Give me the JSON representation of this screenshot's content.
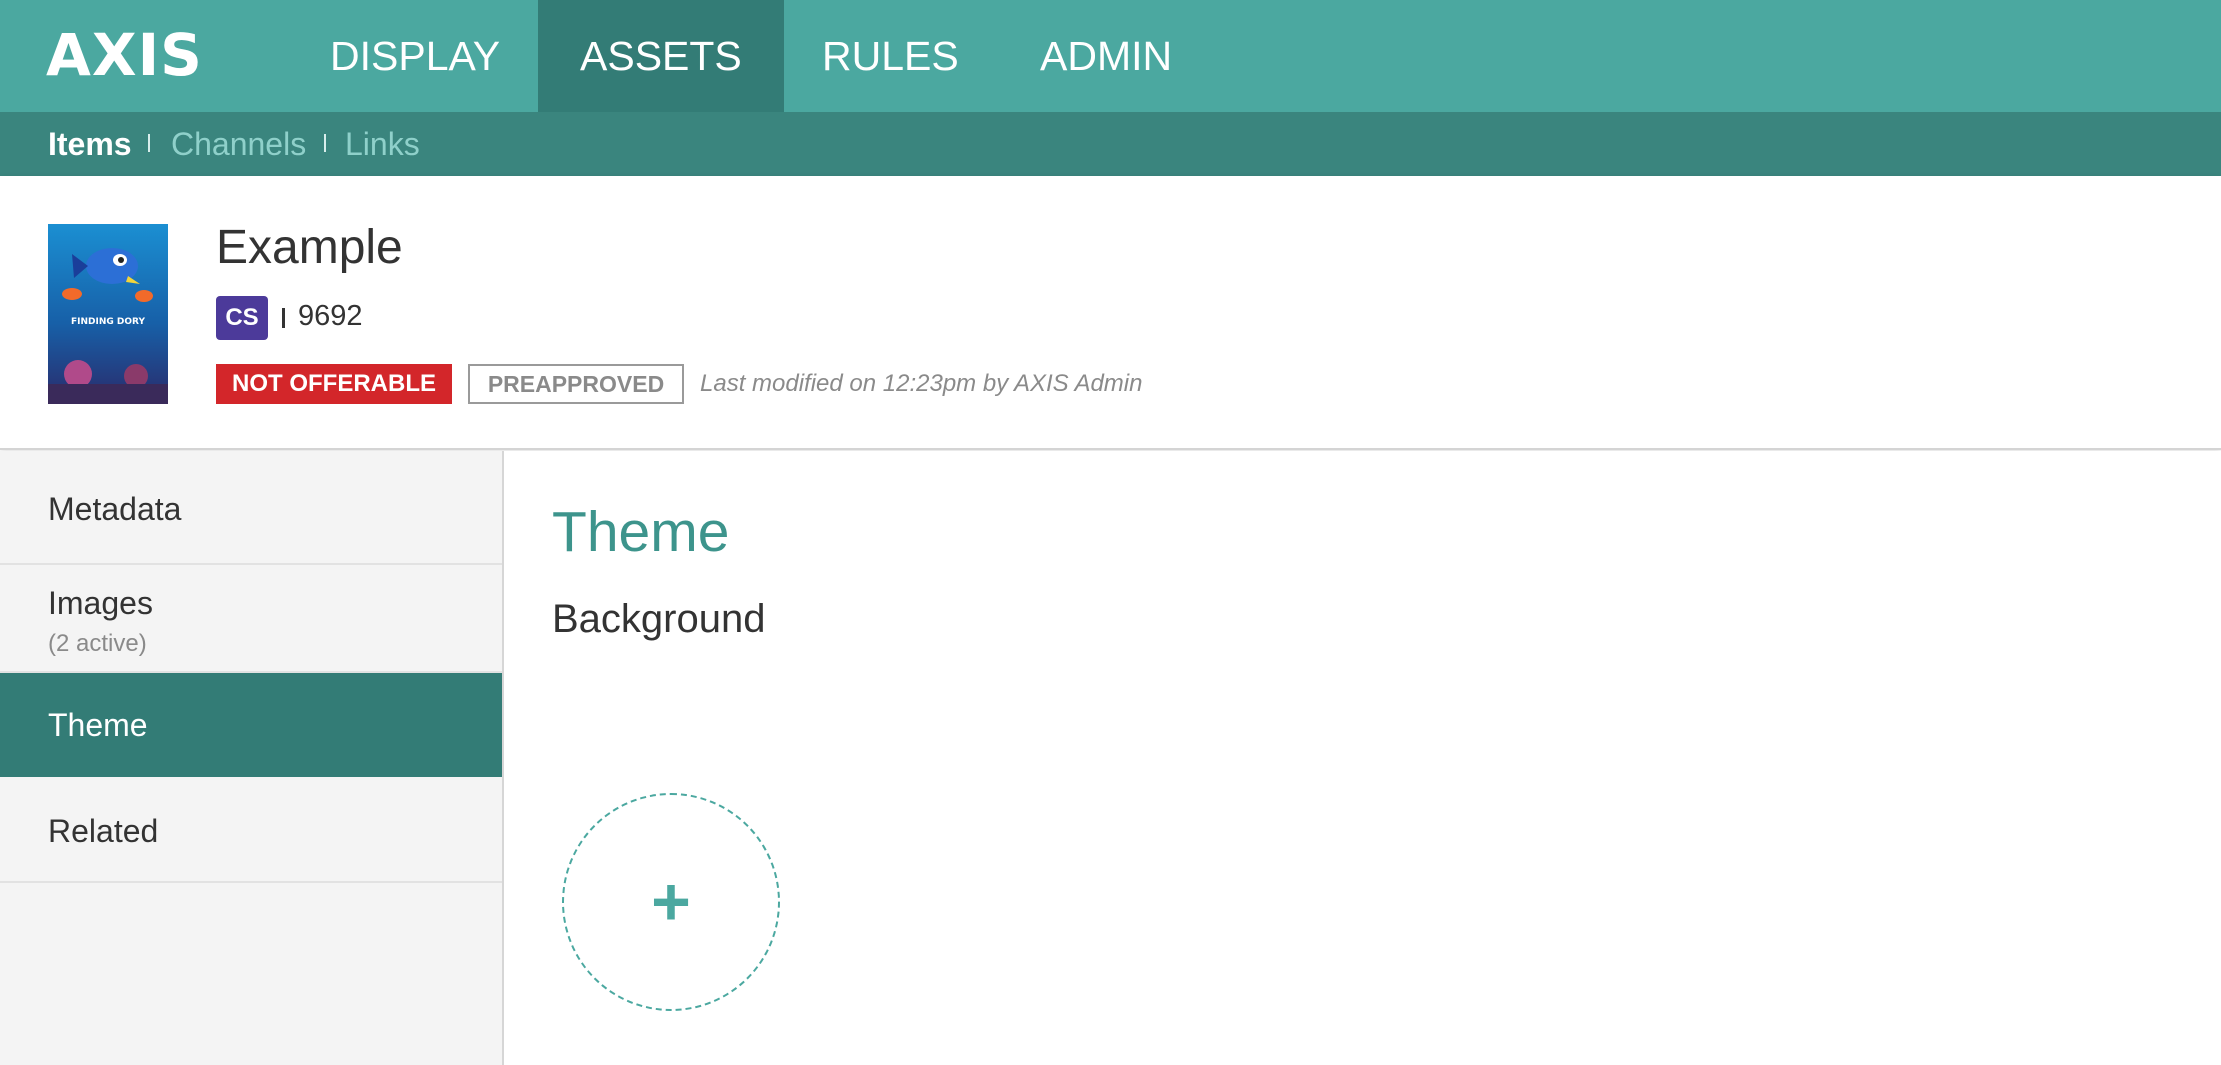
{
  "app": {
    "logo": "AXIS"
  },
  "nav": {
    "tabs": [
      {
        "label": "DISPLAY",
        "active": false
      },
      {
        "label": "ASSETS",
        "active": true
      },
      {
        "label": "RULES",
        "active": false
      },
      {
        "label": "ADMIN",
        "active": false
      }
    ]
  },
  "subnav": {
    "items": [
      {
        "label": "Items",
        "active": true
      },
      {
        "label": "Channels",
        "active": false
      },
      {
        "label": "Links",
        "active": false
      }
    ]
  },
  "asset": {
    "poster_alt": "Finding Dory poster",
    "poster_text": "FINDING DORY",
    "title": "Example",
    "badge": "CS",
    "id": "9692",
    "status_tag": "NOT OFFERABLE",
    "approval_tag": "PREAPPROVED",
    "last_modified": "Last modified on 12:23pm by AXIS Admin"
  },
  "sidebar": {
    "items": [
      {
        "label": "Metadata",
        "sub": ""
      },
      {
        "label": "Images",
        "sub": "(2 active)"
      },
      {
        "label": "Theme",
        "sub": "",
        "active": true
      },
      {
        "label": "Related",
        "sub": ""
      }
    ]
  },
  "main": {
    "section_title": "Theme",
    "subsection_title": "Background",
    "add_icon": "plus-icon"
  },
  "colors": {
    "primary": "#4ba8a0",
    "primary_dark": "#337c76",
    "subnav": "#3a857e",
    "badge_purple": "#4c3a9a",
    "tag_red": "#d3262a"
  }
}
